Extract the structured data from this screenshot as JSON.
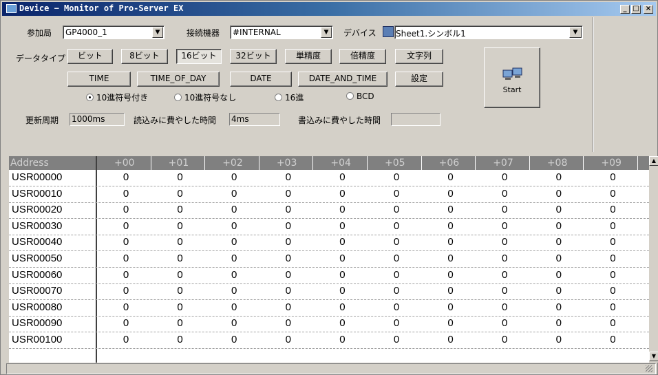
{
  "window": {
    "title": "Device − Monitor of Pro-Server EX"
  },
  "controls": {
    "station_label": "参加局",
    "station_value": "GP4000_1",
    "device_label": "接続機器",
    "device_value": "#INTERNAL",
    "device_type_label": "デバイス",
    "symbol_value": "Sheet1.シンボル1",
    "datatype_label": "データタイプ",
    "datatype_buttons": [
      "ビット",
      "8ビット",
      "16ビット",
      "32ビット",
      "単精度",
      "倍精度",
      "文字列"
    ],
    "datatype_selected": "16ビット",
    "datatype_buttons2": [
      "TIME",
      "TIME_OF_DAY",
      "DATE",
      "DATE_AND_TIME",
      "設定"
    ],
    "radio_options": [
      "10進符号付き",
      "10進符号なし",
      "16進",
      "BCD"
    ],
    "radio_selected": "10進符号付き",
    "update_label": "更新周期",
    "update_value": "1000ms",
    "read_time_label": "読込みに費やした時間",
    "read_time_value": "4ms",
    "write_time_label": "書込みに費やした時間",
    "write_time_value": "",
    "start_label": "Start"
  },
  "grid": {
    "address_header": "Address",
    "columns": [
      "+00",
      "+01",
      "+02",
      "+03",
      "+04",
      "+05",
      "+06",
      "+07",
      "+08",
      "+09"
    ],
    "rows": [
      {
        "address": "USR00000",
        "values": [
          "0",
          "0",
          "0",
          "0",
          "0",
          "0",
          "0",
          "0",
          "0",
          "0"
        ]
      },
      {
        "address": "USR00010",
        "values": [
          "0",
          "0",
          "0",
          "0",
          "0",
          "0",
          "0",
          "0",
          "0",
          "0"
        ]
      },
      {
        "address": "USR00020",
        "values": [
          "0",
          "0",
          "0",
          "0",
          "0",
          "0",
          "0",
          "0",
          "0",
          "0"
        ]
      },
      {
        "address": "USR00030",
        "values": [
          "0",
          "0",
          "0",
          "0",
          "0",
          "0",
          "0",
          "0",
          "0",
          "0"
        ]
      },
      {
        "address": "USR00040",
        "values": [
          "0",
          "0",
          "0",
          "0",
          "0",
          "0",
          "0",
          "0",
          "0",
          "0"
        ]
      },
      {
        "address": "USR00050",
        "values": [
          "0",
          "0",
          "0",
          "0",
          "0",
          "0",
          "0",
          "0",
          "0",
          "0"
        ]
      },
      {
        "address": "USR00060",
        "values": [
          "0",
          "0",
          "0",
          "0",
          "0",
          "0",
          "0",
          "0",
          "0",
          "0"
        ]
      },
      {
        "address": "USR00070",
        "values": [
          "0",
          "0",
          "0",
          "0",
          "0",
          "0",
          "0",
          "0",
          "0",
          "0"
        ]
      },
      {
        "address": "USR00080",
        "values": [
          "0",
          "0",
          "0",
          "0",
          "0",
          "0",
          "0",
          "0",
          "0",
          "0"
        ]
      },
      {
        "address": "USR00090",
        "values": [
          "0",
          "0",
          "0",
          "0",
          "0",
          "0",
          "0",
          "0",
          "0",
          "0"
        ]
      },
      {
        "address": "USR00100",
        "values": [
          "0",
          "0",
          "0",
          "0",
          "0",
          "0",
          "0",
          "0",
          "0",
          "0"
        ]
      }
    ]
  }
}
